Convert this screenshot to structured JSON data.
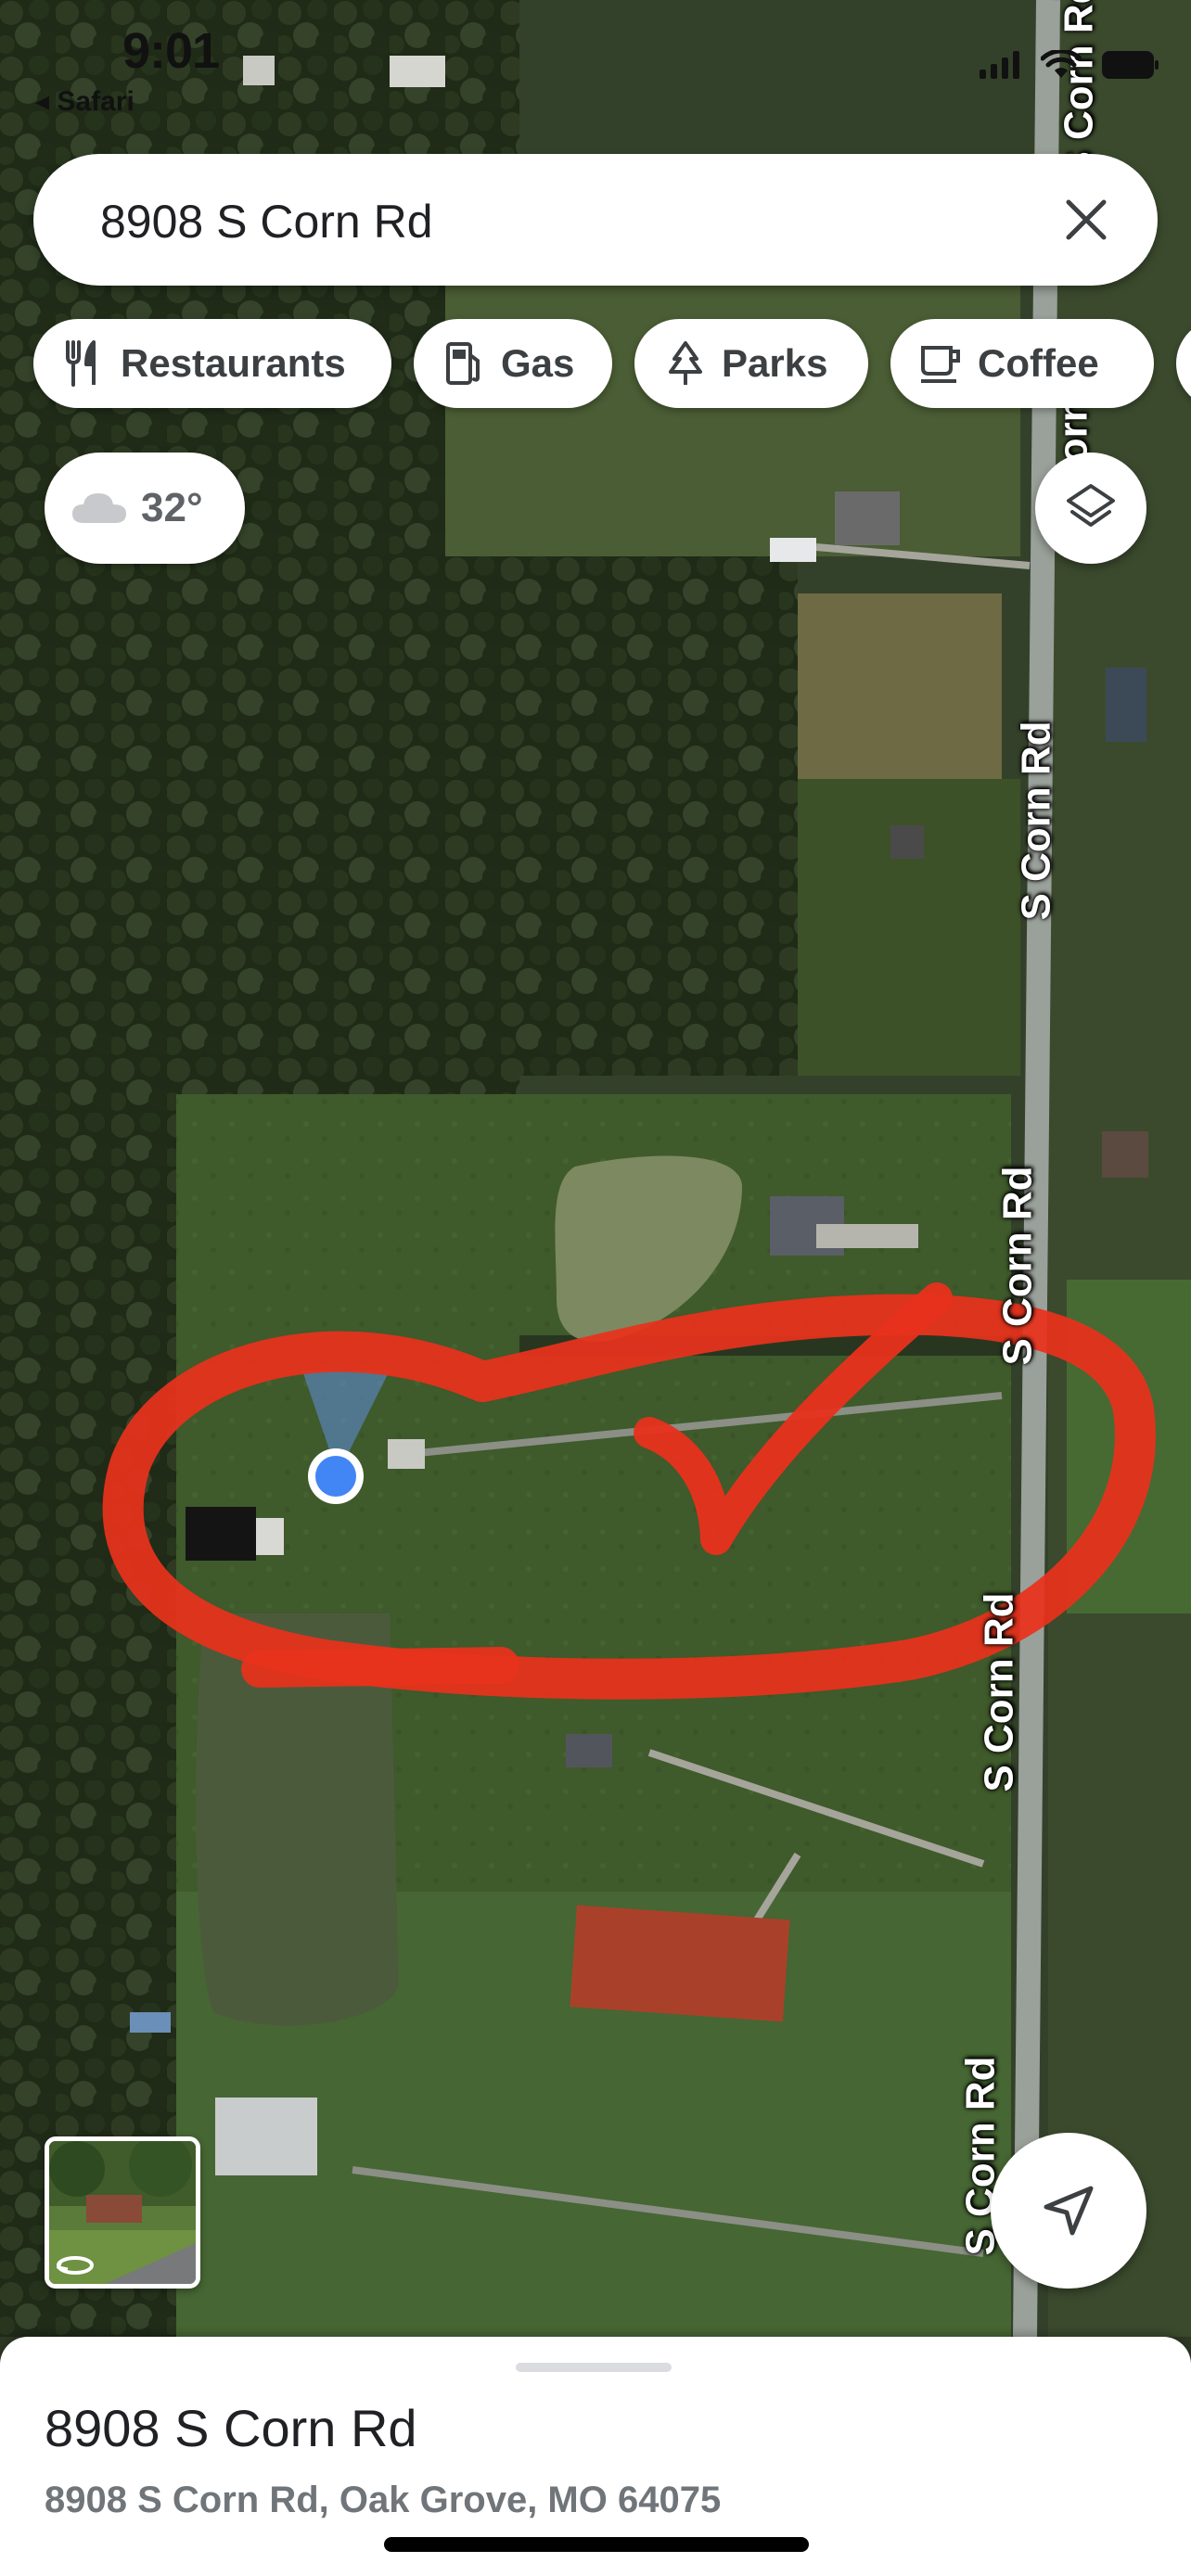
{
  "status_bar": {
    "time": "9:01",
    "back_app": "◂ Safari"
  },
  "search": {
    "query": "8908 S Corn Rd"
  },
  "chips": [
    {
      "label": "Restaurants",
      "icon": "fork-knife-icon"
    },
    {
      "label": "Gas",
      "icon": "gas-pump-icon"
    },
    {
      "label": "Parks",
      "icon": "tree-icon"
    },
    {
      "label": "Coffee",
      "icon": "coffee-cup-icon"
    }
  ],
  "weather": {
    "temperature": "32°",
    "icon": "cloudy-icon"
  },
  "map": {
    "road_labels": [
      "S Corn Rd",
      "S Corn Rd",
      "S Corn Rd",
      "S Corn Rd",
      "S Corn Rd"
    ],
    "annotation_color": "#e8321c",
    "location_dot_color": "#4285f4"
  },
  "place": {
    "title": "8908 S Corn Rd",
    "address": "8908 S Corn Rd, Oak Grove, MO 64075"
  },
  "icons": {
    "layers": "layers-icon",
    "locate": "navigation-arrow-icon",
    "clear": "close-icon",
    "streetview": "streetview-rotate-icon"
  }
}
